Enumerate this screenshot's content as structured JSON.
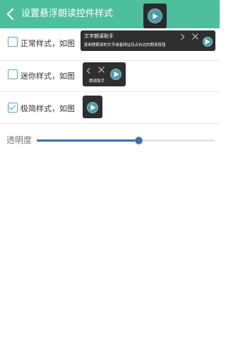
{
  "appbar": {
    "title": "设置悬浮朗读控件样式",
    "background": "#4dbf9c"
  },
  "options": [
    {
      "label": "正常样式，如图",
      "checked": false
    },
    {
      "label": "迷你样式，如图",
      "checked": false
    },
    {
      "label": "极简样式，如图",
      "checked": true
    }
  ],
  "previews": {
    "normal": {
      "title": "文字朗读助手",
      "hint": "复制想朗读的文字或者网址后点右边的朗读按钮"
    },
    "mini": {
      "caption": "朗读助手"
    }
  },
  "opacity": {
    "label": "透明度",
    "value_fraction": 0.57
  },
  "colors": {
    "accent": "#4dbf9c",
    "checkbox": "#56a5d0",
    "slider": "#3f6fa8",
    "float_bg": "#2f2f2f"
  }
}
